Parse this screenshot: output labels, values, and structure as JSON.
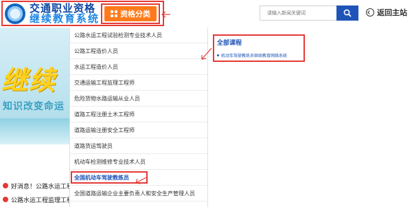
{
  "header": {
    "logo_line1": "交通职业资格",
    "logo_line2": "继续教育系统",
    "category_button": "资格分类",
    "search_placeholder": "请输入新闻关键词",
    "back_home": "返回主站"
  },
  "banner": {
    "big_text": "继续",
    "small_text": "知识改变命运"
  },
  "news": [
    {
      "text": "好消息！公路水运工程监",
      "color": "#e53935"
    },
    {
      "text": "公路水运工程监理工程师",
      "color": "#e53935"
    }
  ],
  "dropdown": {
    "items": [
      "公路水运工程试验检测专业技术人员",
      "公路工程造价人员",
      "水运工程造价人员",
      "交通运输工程监理工程师",
      "危险货物水路运输从业人员",
      "道路工程注册土木工程师",
      "道路运输注册安全工程师",
      "道路货运驾驶员",
      "机动车检测维修专业技术人员"
    ],
    "active_item": "全国机动车驾驶教练员",
    "last_item": "全国道路运输企业主要负责人和安全生产管理人员"
  },
  "course_panel": {
    "title": "全部课程",
    "item": "机动车驾驶教练员继续教育网络系统"
  },
  "colors": {
    "accent_blue": "#1e54b7",
    "orange": "#ff7a1a",
    "annotation_red": "#e53935"
  }
}
